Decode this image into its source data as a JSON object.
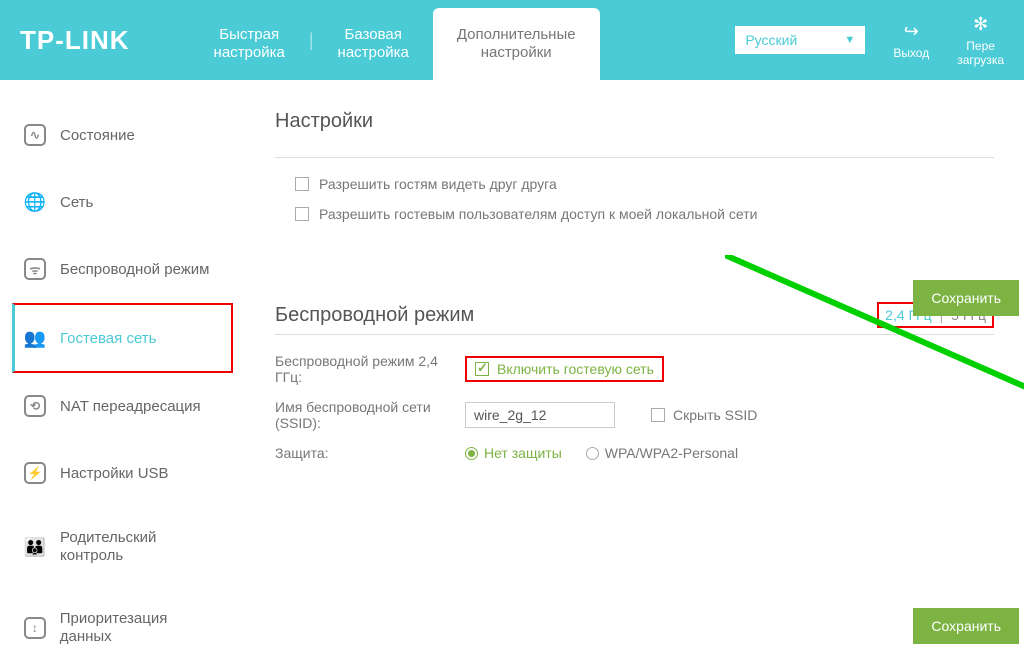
{
  "logo": "TP-LINK",
  "header": {
    "tabs": [
      {
        "label": "Быстрая\nнастройка"
      },
      {
        "label": "Базовая\nнастройка"
      },
      {
        "label": "Дополнительные\nнастройки"
      }
    ],
    "language": "Русский",
    "logout": "Выход",
    "reload": "Пере\nзагрузка"
  },
  "sidebar": {
    "items": [
      {
        "label": "Состояние"
      },
      {
        "label": "Сеть"
      },
      {
        "label": "Беспроводной режим"
      },
      {
        "label": "Гостевая сеть"
      },
      {
        "label": "NAT переадресация"
      },
      {
        "label": "Настройки USB"
      },
      {
        "label": "Родительский контроль"
      },
      {
        "label": "Приоритезация данных"
      }
    ]
  },
  "content": {
    "section1_title": "Настройки",
    "check1": "Разрешить гостям видеть друг друга",
    "check2": "Разрешить гостевым пользователям доступ к моей локальной сети",
    "save": "Сохранить",
    "section2_title": "Беспроводной режим",
    "freq24": "2,4 ГГц",
    "freq5": "5 ГГц",
    "row1_label": "Беспроводной режим 2,4 ГГц:",
    "row1_enable": "Включить гостевую сеть",
    "row2_label": "Имя беспроводной сети (SSID):",
    "row2_value": "wire_2g_12",
    "row2_hide": "Скрыть SSID",
    "row3_label": "Защита:",
    "row3_opt1": "Нет защиты",
    "row3_opt2": "WPA/WPA2-Personal"
  }
}
